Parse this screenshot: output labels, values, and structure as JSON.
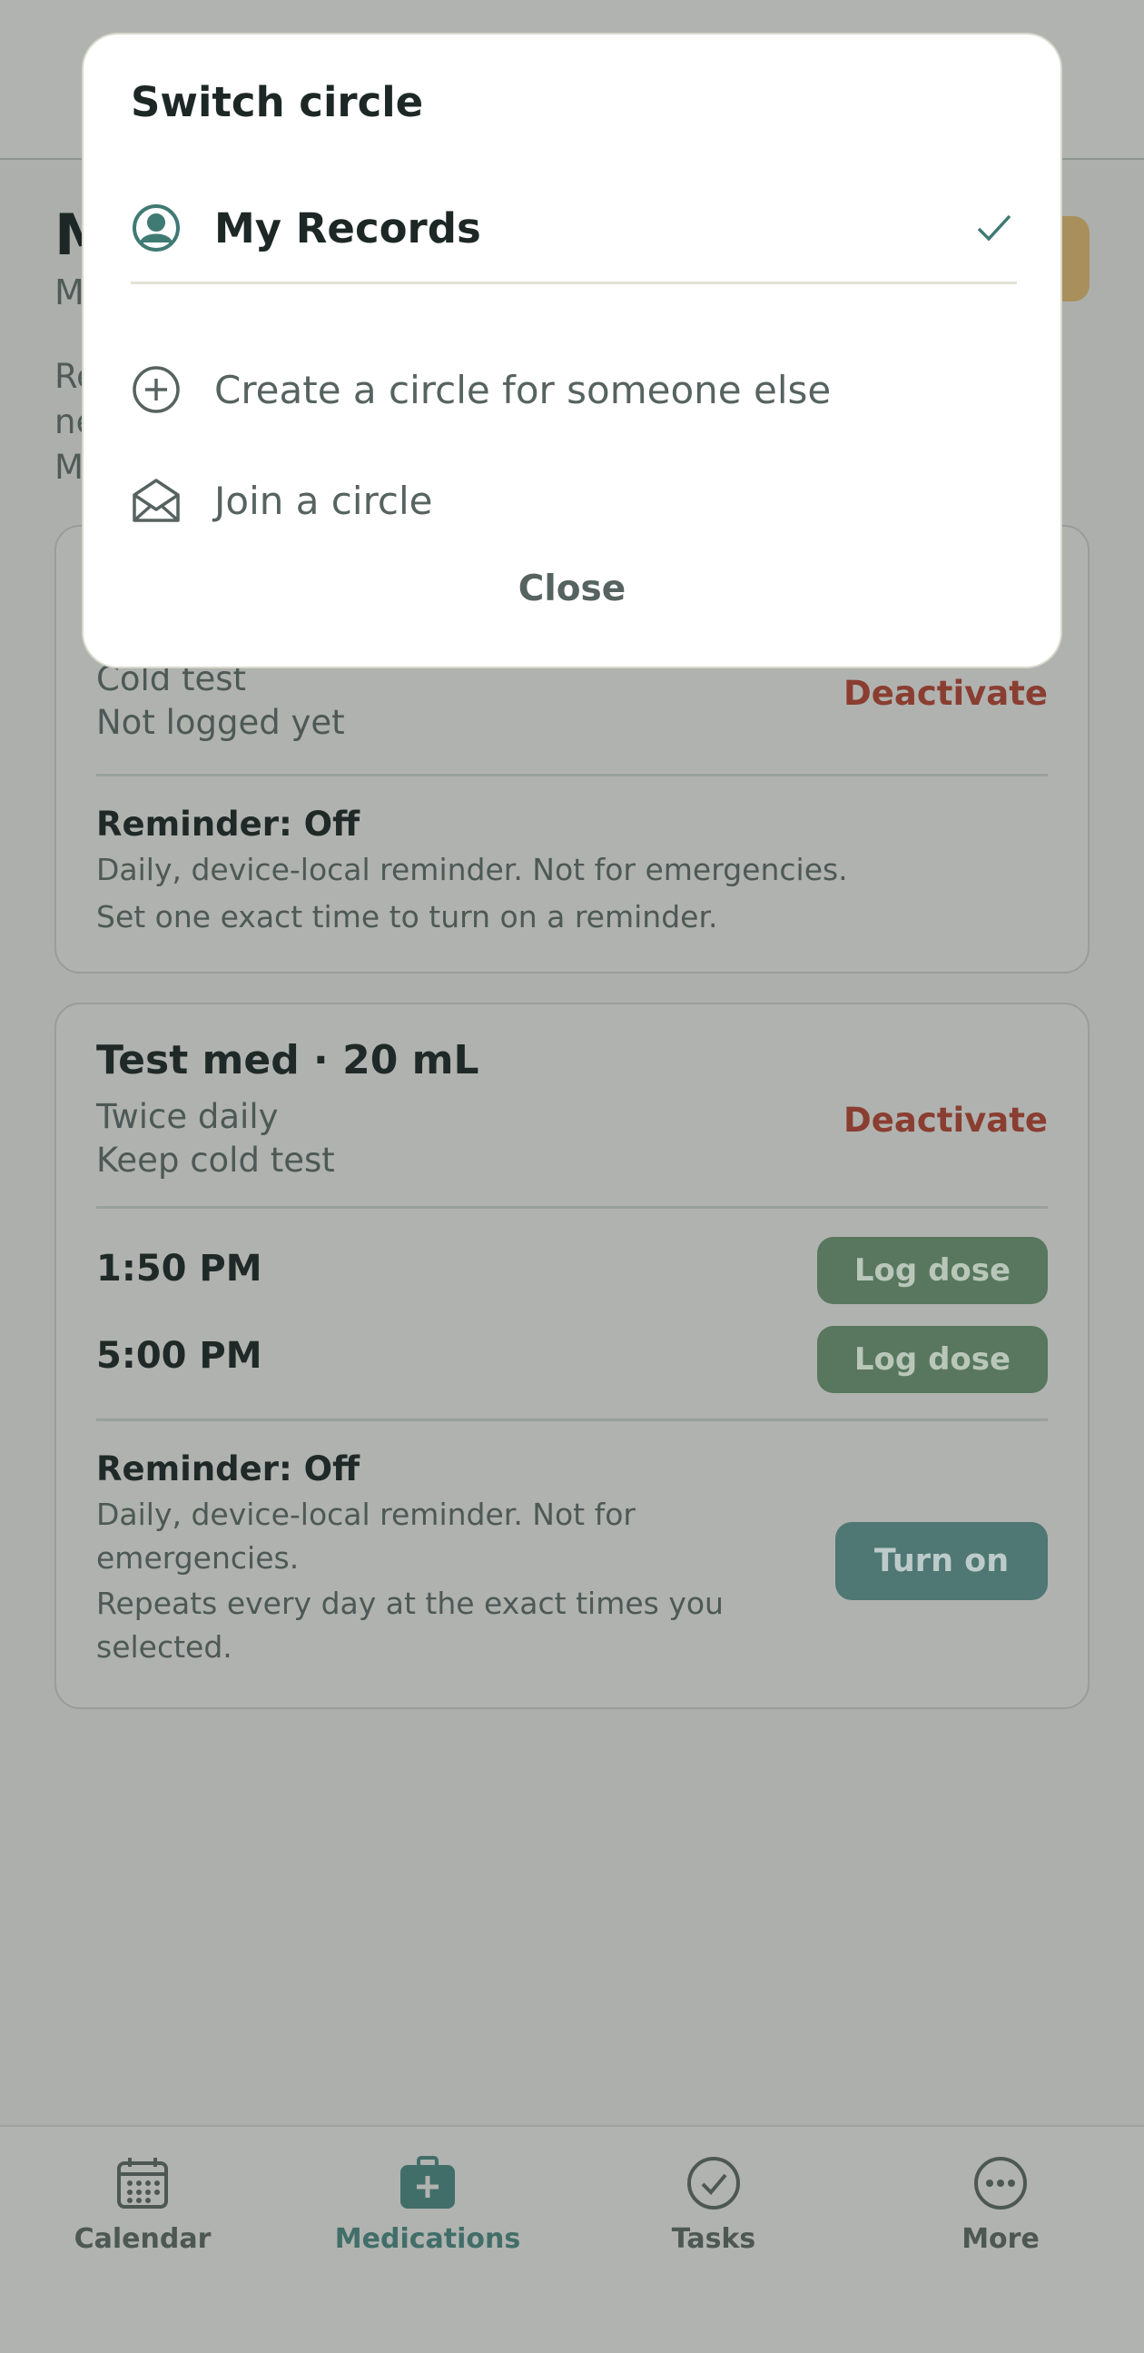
{
  "page": {
    "title": "M",
    "subtitle": "M",
    "intro": "Re\nne\nM"
  },
  "medications": [
    {
      "line1": "Cold test",
      "line2": "Not logged yet",
      "deactivate_label": "Deactivate",
      "reminder_title": "Reminder: Off",
      "reminder_text_1": "Daily, device-local reminder. Not for emergencies.",
      "reminder_text_2": "Set one exact time to turn on a reminder."
    },
    {
      "title": "Test med · 20 mL",
      "line1": "Twice daily",
      "line2": "Keep cold test",
      "deactivate_label": "Deactivate",
      "doses": [
        {
          "time": "1:50 PM",
          "button": "Log dose"
        },
        {
          "time": "5:00 PM",
          "button": "Log dose"
        }
      ],
      "reminder_title": "Reminder: Off",
      "reminder_text_1": "Daily, device-local reminder. Not for emergencies.",
      "reminder_text_2": "Repeats every day at the exact times you selected.",
      "turn_on_label": "Turn on"
    }
  ],
  "bottom_nav": {
    "items": [
      {
        "label": "Calendar",
        "icon": "calendar-icon"
      },
      {
        "label": "Medications",
        "icon": "medkit-icon",
        "active": true
      },
      {
        "label": "Tasks",
        "icon": "check-circle-icon"
      },
      {
        "label": "More",
        "icon": "more-icon"
      }
    ]
  },
  "modal": {
    "title": "Switch circle",
    "current": {
      "label": "My Records",
      "icon": "user-circle-icon",
      "selected": true
    },
    "options": [
      {
        "label": "Create a circle for someone else",
        "icon": "plus-circle-icon"
      },
      {
        "label": "Join a circle",
        "icon": "envelope-open-icon"
      }
    ],
    "close_label": "Close"
  },
  "colors": {
    "accent": "#3f7a73",
    "danger": "#8a3e31",
    "log_button": "#58775e",
    "overlay_background": "#adafac"
  }
}
